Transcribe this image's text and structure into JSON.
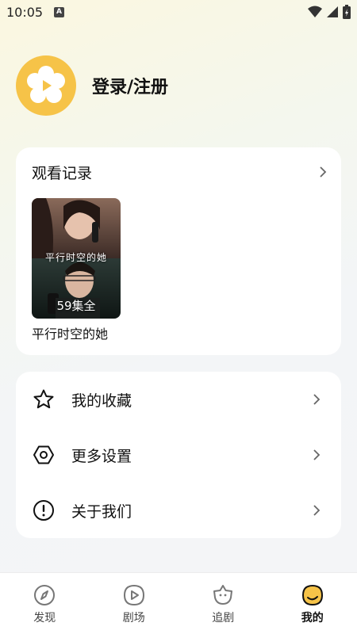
{
  "status_bar": {
    "time": "10:05",
    "notification_letter": "A"
  },
  "profile": {
    "login_label": "登录/注册"
  },
  "history": {
    "title": "观看记录",
    "items": [
      {
        "title": "平行时空的她",
        "episodes_badge": "59集全",
        "poster_text": "平行时空的她"
      }
    ]
  },
  "menu": [
    {
      "label": "我的收藏",
      "icon": "star-icon"
    },
    {
      "label": "更多设置",
      "icon": "settings-icon"
    },
    {
      "label": "关于我们",
      "icon": "info-icon"
    }
  ],
  "bottom_nav": [
    {
      "label": "发现",
      "icon": "compass-icon"
    },
    {
      "label": "剧场",
      "icon": "play-icon"
    },
    {
      "label": "追剧",
      "icon": "star-face-icon"
    },
    {
      "label": "我的",
      "icon": "profile-icon",
      "active": true
    }
  ],
  "colors": {
    "accent": "#f6c348",
    "background": "#f4f5f7",
    "card": "#ffffff"
  }
}
